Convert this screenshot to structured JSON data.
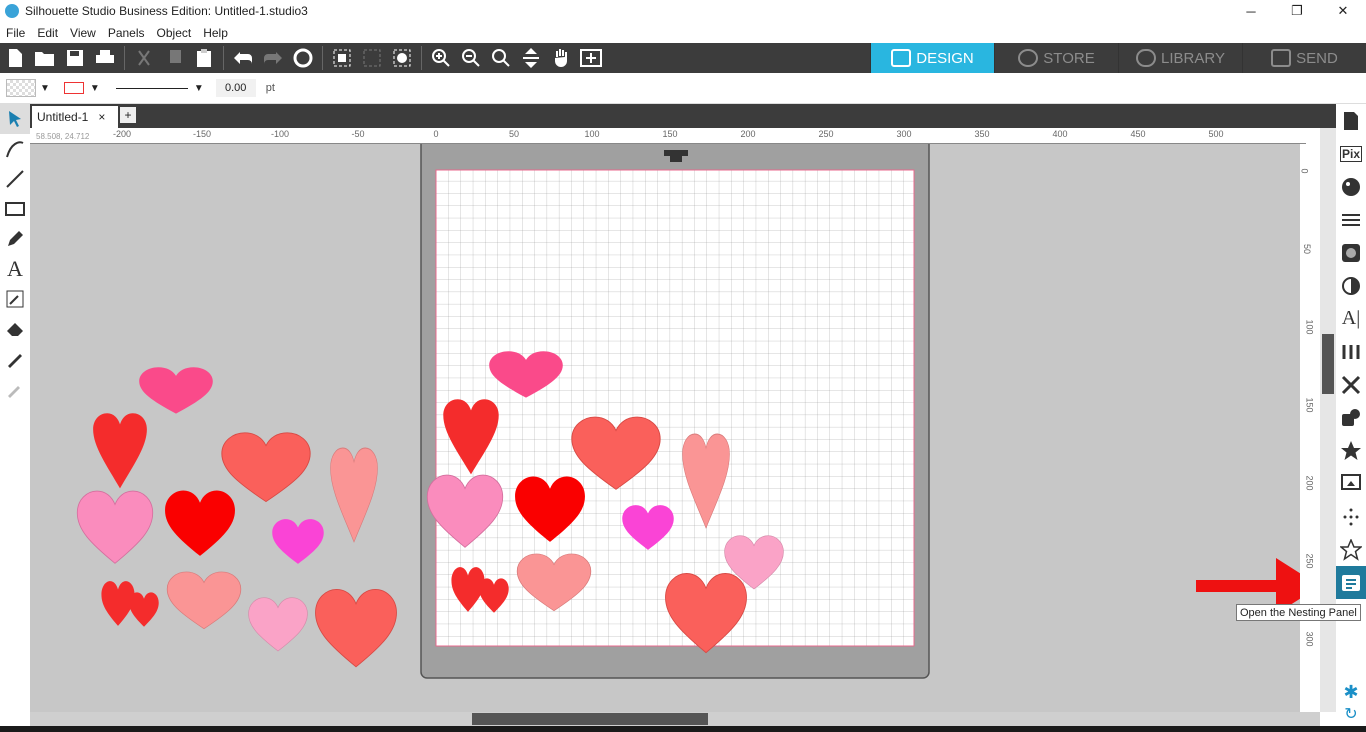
{
  "window": {
    "title": "Silhouette Studio Business Edition: Untitled-1.studio3",
    "minimize": "─",
    "restore": "❐",
    "close": "✕"
  },
  "menu": [
    "File",
    "Edit",
    "View",
    "Panels",
    "Object",
    "Help"
  ],
  "nav_tabs": [
    {
      "label": "DESIGN",
      "active": true
    },
    {
      "label": "STORE",
      "active": false
    },
    {
      "label": "LIBRARY",
      "active": false
    },
    {
      "label": "SEND",
      "active": false
    }
  ],
  "props": {
    "line_weight_value": "0.00",
    "line_weight_unit": "pt"
  },
  "document": {
    "tab_label": "Untitled-1",
    "close_glyph": "×",
    "add_glyph": "+",
    "cursor_readout": "58.508, 24.712"
  },
  "ruler": {
    "h_ticks": [
      "-200",
      "-150",
      "-100",
      "-50",
      "0",
      "50",
      "100",
      "150",
      "200",
      "250",
      "300",
      "350",
      "400",
      "450",
      "500"
    ],
    "v_ticks": [
      "0",
      "50",
      "100",
      "150",
      "200",
      "250",
      "300"
    ]
  },
  "tooltip": "Open the Nesting Panel",
  "colors": {
    "accent": "#29b6e0",
    "toolbar_bg": "#3c3c3c",
    "canvas_bg": "#c7c7c7",
    "mat_gray": "#a0a0a0",
    "arrow": "#ee1111"
  },
  "hearts": [
    {
      "color": "#fa4a8a"
    },
    {
      "color": "#f42c2c"
    },
    {
      "color": "#fa605b"
    },
    {
      "color": "#fa9595"
    },
    {
      "color": "#fa8cbd"
    },
    {
      "color": "#fa0000"
    },
    {
      "color": "#fa44d6"
    },
    {
      "color": "#f42c2c"
    },
    {
      "color": "#fa9595"
    },
    {
      "color": "#faa3c7"
    },
    {
      "color": "#fa605b"
    }
  ]
}
